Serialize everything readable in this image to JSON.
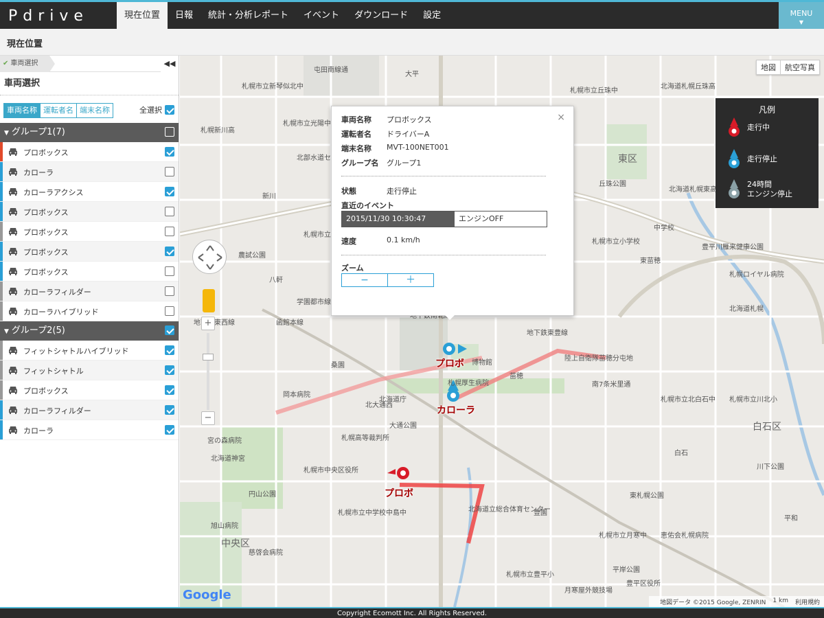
{
  "header": {
    "logo": "Pdrive",
    "nav": [
      "現在位置",
      "日報",
      "統計・分析レポート",
      "イベント",
      "ダウンロード",
      "設定"
    ],
    "menu_label": "MENU"
  },
  "page_title": "現在位置",
  "sidebar": {
    "breadcrumb": "車両選択",
    "collapse": "◀◀",
    "title": "車両選択",
    "tabs": [
      "車両名称",
      "運転者名",
      "端末名称"
    ],
    "select_all": "全選択",
    "groups": [
      {
        "name": "グループ1(7)",
        "checked": false,
        "vehicles": [
          {
            "name": "プロボックス",
            "checked": true,
            "color": "#e24a2b"
          },
          {
            "name": "カローラ",
            "checked": false,
            "color": "#2a9fd6"
          },
          {
            "name": "カローラアクシス",
            "checked": true,
            "color": "#2a9fd6"
          },
          {
            "name": "プロボックス",
            "checked": false,
            "color": "#2a9fd6"
          },
          {
            "name": "プロボックス",
            "checked": false,
            "color": "#999999"
          },
          {
            "name": "プロボックス",
            "checked": true,
            "color": "#2a9fd6"
          },
          {
            "name": "プロボックス",
            "checked": false,
            "color": "#2a9fd6"
          },
          {
            "name": "カローラフィルダー",
            "checked": false,
            "color": "#999999"
          },
          {
            "name": "カローラハイブリッド",
            "checked": false,
            "color": "#999999"
          }
        ]
      },
      {
        "name": "グループ2(5)",
        "checked": true,
        "vehicles": [
          {
            "name": "フィットシャトルハイブリッド",
            "checked": true,
            "color": "#999999"
          },
          {
            "name": "フィットシャトル",
            "checked": true,
            "color": "#999999"
          },
          {
            "name": "プロボックス",
            "checked": true,
            "color": "#999999"
          },
          {
            "name": "カローラフィルダー",
            "checked": true,
            "color": "#2a9fd6"
          },
          {
            "name": "カローラ",
            "checked": true,
            "color": "#2a9fd6"
          }
        ]
      }
    ]
  },
  "map": {
    "type_buttons": [
      "地図",
      "航空写真"
    ],
    "legend": {
      "title": "凡例",
      "items": [
        "走行中",
        "走行停止",
        "24時間\nエンジン停止"
      ]
    },
    "popup": {
      "vehicle_label": "車両名称",
      "vehicle": "プロボックス",
      "driver_label": "運転者名",
      "driver": "ドライバーA",
      "device_label": "端末名称",
      "device": "MVT-100NET001",
      "group_label": "グループ名",
      "group": "グループ1",
      "status_label": "状態",
      "status": "走行停止",
      "event_label": "直近のイベント",
      "event_time": "2015/11/30 10:30:47",
      "event_text": "エンジンOFF",
      "speed_label": "速度",
      "speed": "0.1 km/h",
      "zoom_label": "ズーム",
      "zoom_out": "−",
      "zoom_in": "＋",
      "close": "×"
    },
    "vehicle_labels": [
      "プロボ",
      "カローラ",
      "プロボ"
    ],
    "place_labels": [
      "札幌市立新琴似北中",
      "屯田南線通",
      "大平",
      "札幌市立丘珠中",
      "北海道札幌丘珠高",
      "札幌新川高",
      "札幌市立光陽中",
      "東区",
      "丘珠公園",
      "北海道札幌東高",
      "北部水道センター",
      "新川",
      "札幌市立新陽小",
      "農試公園",
      "八軒",
      "学園都市線",
      "札幌市立小学校",
      "中学校",
      "東苗穂",
      "豊平川雁来健康公園",
      "札幌ロイヤル病院",
      "北海道札幌",
      "地下鉄東西線",
      "函館本線",
      "地下鉄東豊線",
      "地下鉄南北線",
      "桑園",
      "北海道庁",
      "博物館",
      "陸上自衛隊苗穂分屯地",
      "札幌厚生病院",
      "苗穂",
      "岡本病院",
      "北大通西",
      "大通公園",
      "札幌高等裁判所",
      "南7条米里通",
      "札幌市立北白石中",
      "札幌市立川北小",
      "白石区",
      "川下公園",
      "宮の森病院",
      "北海道神宮",
      "札幌市中央区役所",
      "円山公園",
      "中央区",
      "旭山病院",
      "慈啓会病院",
      "札幌市立中学校",
      "中島中",
      "北海道立総合体育センター",
      "豊園",
      "札幌市立月寒中",
      "恵佑会札幌病院",
      "白石",
      "東札幌公園",
      "平和",
      "札幌市立豊平小",
      "月寒屋外競技場",
      "平岸公園",
      "豊平区役所"
    ],
    "attribution": [
      "地図データ ©2015 Google, ZENRIN",
      "1 km",
      "利用規約"
    ],
    "google": "Google"
  },
  "footer": "Copyright Ecomott Inc. All Rights Reserved."
}
